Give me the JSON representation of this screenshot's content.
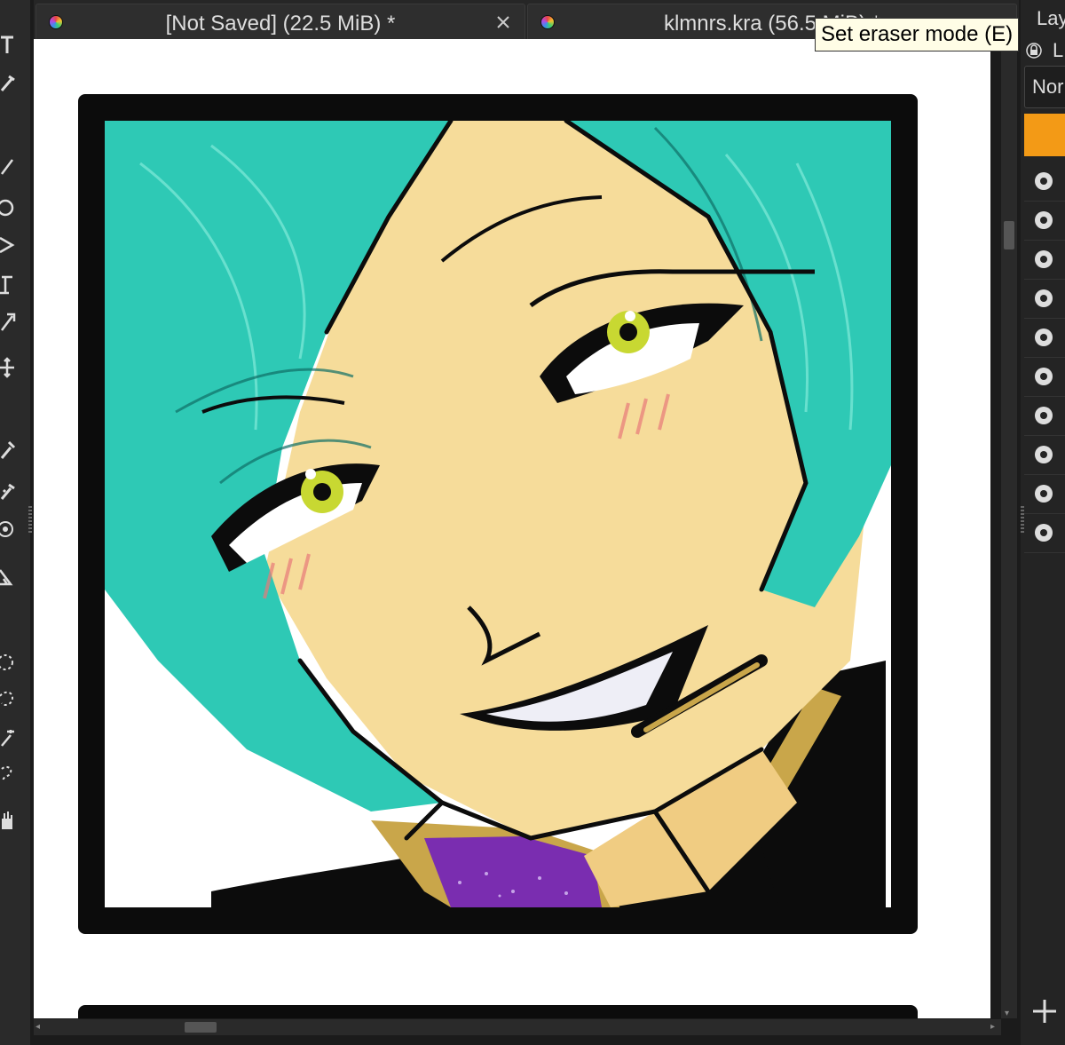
{
  "tabs": [
    {
      "title": "[Not Saved]  (22.5 MiB) *",
      "has_close": true
    },
    {
      "title": "klmnrs.kra (56.5 MiB) *",
      "has_close": false
    }
  ],
  "tooltip": {
    "text": "Set eraser mode (E)"
  },
  "layers_panel": {
    "title": "Lay",
    "lock_label": "L",
    "blend_mode": "Nor",
    "add_label": "+",
    "active_color": "#f39a16",
    "rows": 10
  },
  "toolbox": {
    "icons": [
      "text-tool-icon",
      "calligraphy-icon",
      "line-tool-icon",
      "ellipse-tool-icon",
      "polygon-tool-icon",
      "bezier-tool-icon",
      "freehand-path-icon",
      "move-tool-icon",
      "eyedropper-icon",
      "smart-patch-icon",
      "assistant-tool-icon",
      "measure-tool-icon",
      "elliptical-select-icon",
      "freehand-select-icon",
      "magic-wand-icon",
      "similar-select-icon",
      "pan-tool-icon"
    ]
  },
  "canvas": {
    "description_colors": {
      "hair": "#2ec9b5",
      "skin": "#f6dc9a",
      "frame": "#0c0c0c",
      "collar": "#7a2db0"
    }
  }
}
